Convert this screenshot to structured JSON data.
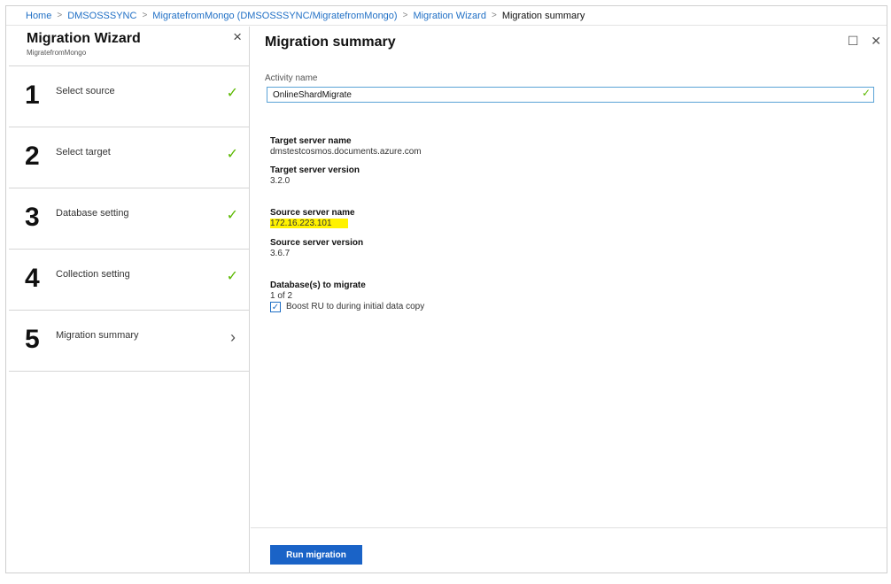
{
  "breadcrumb": {
    "items": [
      "Home",
      "DMSOSSSYNC",
      "MigratefromMongo (DMSOSSSYNC/MigratefromMongo)",
      "Migration Wizard"
    ],
    "current": "Migration summary",
    "separator": ">"
  },
  "wizard": {
    "title": "Migration Wizard",
    "subtitle": "MigratefromMongo",
    "close_icon": "×",
    "steps": [
      {
        "number": "1",
        "label": "Select source",
        "status": "✓"
      },
      {
        "number": "2",
        "label": "Select target",
        "status": "✓"
      },
      {
        "number": "3",
        "label": "Database setting",
        "status": "✓"
      },
      {
        "number": "4",
        "label": "Collection setting",
        "status": "✓"
      },
      {
        "number": "5",
        "label": "Migration summary",
        "status": "›"
      }
    ]
  },
  "summary": {
    "title": "Migration summary",
    "maximize_icon": "☐",
    "close_icon": "✕",
    "activity_label": "Activity name",
    "activity_value": "OnlineShardMigrate",
    "input_check": "✓",
    "target_name_label": "Target server name",
    "target_name_value": "dmstestcosmos.documents.azure.com",
    "target_version_label": "Target server version",
    "target_version_value": "3.2.0",
    "source_name_label": "Source server name",
    "source_name_value": "172.16.223.101",
    "source_version_label": "Source server version",
    "source_version_value": "3.6.7",
    "db_label": "Database(s) to migrate",
    "db_value": "1 of 2",
    "boost_label": "Boost RU to during initial data copy",
    "boost_checked": "✓",
    "run_button": "Run migration"
  },
  "colors": {
    "accent": "#1a63c7",
    "link": "#1f6fc5",
    "check": "#5bb800",
    "highlight": "#fff200"
  }
}
